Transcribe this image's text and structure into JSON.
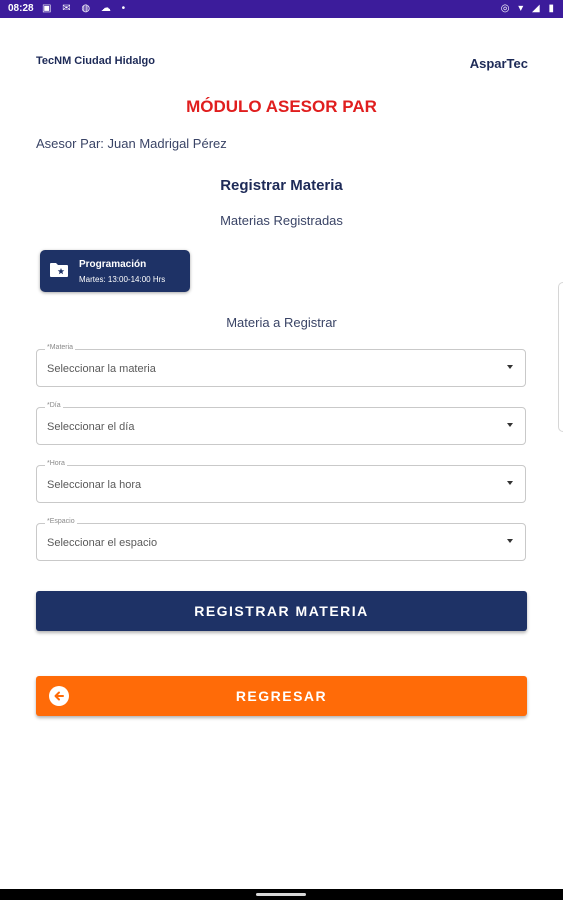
{
  "status_bar": {
    "time": "08:28",
    "left_icons": "▣ ✉ ◍ ☁ •",
    "right_icons": "◎ ▾ ◢ ▮"
  },
  "header": {
    "institution": "TecNM Ciudad Hidalgo",
    "brand": "AsparTec",
    "module_title": "MÓDULO ASESOR PAR",
    "asesor": "Asesor Par: Juan Madrigal Pérez"
  },
  "main": {
    "title": "Registrar Materia",
    "registered_heading": "Materias Registradas",
    "registered": [
      {
        "name": "Programación",
        "schedule": "Martes: 13:00-14:00 Hrs"
      }
    ],
    "to_register_heading": "Materia a Registrar",
    "fields": {
      "materia": {
        "label": "*Materia",
        "placeholder": "Seleccionar la materia"
      },
      "dia": {
        "label": "*Día",
        "placeholder": "Seleccionar el día"
      },
      "hora": {
        "label": "*Hora",
        "placeholder": "Seleccionar la hora"
      },
      "espacio": {
        "label": "*Espacio",
        "placeholder": "Seleccionar el espacio"
      }
    },
    "register_button": "REGISTRAR MATERIA",
    "back_button": "REGRESAR"
  },
  "colors": {
    "primary": "#1e3266",
    "accent": "#ff6b08",
    "title_red": "#e01e1e",
    "status_bar": "#3c1c9b"
  },
  "icons": {
    "chip_icon": "folder-star-icon",
    "back_icon": "arrow-left-circle-icon"
  }
}
